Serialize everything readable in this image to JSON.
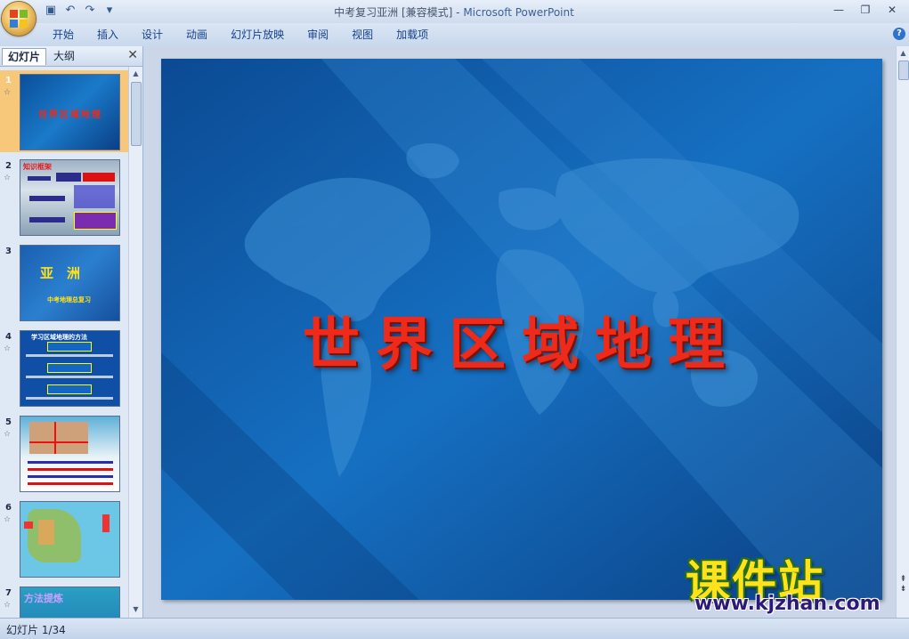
{
  "window": {
    "title": "中考复习亚洲 [兼容模式] - ",
    "app_name": "Microsoft PowerPoint"
  },
  "quick_access": {
    "icons": [
      "save-icon",
      "undo-icon",
      "redo-icon",
      "customize-icon"
    ]
  },
  "ribbon": {
    "tabs": [
      "开始",
      "插入",
      "设计",
      "动画",
      "幻灯片放映",
      "审阅",
      "视图",
      "加载项"
    ]
  },
  "slide_panel": {
    "tabs": [
      "幻灯片",
      "大纲"
    ],
    "thumbnails": [
      {
        "number": "1",
        "text": "世界区域地理"
      },
      {
        "number": "2",
        "text": "知识框架"
      },
      {
        "number": "3",
        "text": "亚　洲",
        "subtext": "中考地理总复习"
      },
      {
        "number": "4",
        "text": "学习区域地理的方法"
      },
      {
        "number": "5",
        "text": ""
      },
      {
        "number": "6",
        "text": ""
      },
      {
        "number": "7",
        "text": "方法提炼"
      }
    ]
  },
  "slide": {
    "title": "世界区域地理"
  },
  "status": {
    "slide_indicator": "幻灯片 1/34"
  },
  "watermark": {
    "cn": "课件站",
    "url": "www.kjzhan.com"
  },
  "colors": {
    "slide_bg": "#0f5fb0",
    "title_red": "#ee2a1a",
    "selection": "#f7c77a"
  }
}
